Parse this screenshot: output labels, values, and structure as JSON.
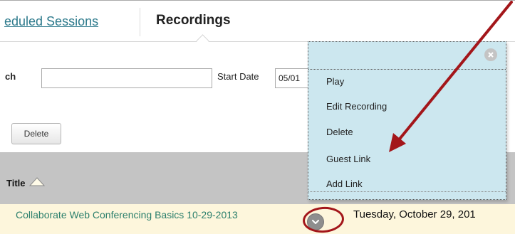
{
  "tabs": {
    "scheduled_label": "eduled Sessions",
    "recordings_label": "Recordings"
  },
  "search": {
    "label": "ch",
    "value": "",
    "start_date_label": "Start Date",
    "start_date_value": "05/01"
  },
  "actions": {
    "delete_label": "Delete"
  },
  "table": {
    "title_header": "Title",
    "rows": [
      {
        "title": "Collaborate Web Conferencing Basics 10-29-2013",
        "date": "Tuesday, October 29, 201"
      }
    ]
  },
  "context_menu": {
    "items": [
      "Play",
      "Edit Recording",
      "Delete",
      "Guest Link",
      "Add Link"
    ]
  },
  "icons": {
    "close": "close-icon",
    "sort": "sort-ascending-icon",
    "chevron": "chevron-down-icon"
  },
  "colors": {
    "link": "#2d7a8c",
    "row_link": "#2b7f6c",
    "menu_bg": "#cce7ef",
    "header_bg": "#c4c4c4",
    "row_bg": "#fdf6dc",
    "annotation": "#a3161a"
  }
}
